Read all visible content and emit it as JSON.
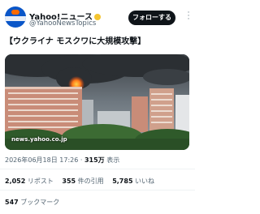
{
  "tweet": {
    "author_name": "Yahoo!ニュース",
    "author_handle": "@YahooNewsTopics",
    "follow_label": "フォローする",
    "text": "【ウクライナ モスクワに大規模攻撃】",
    "image_watermark": "news.yahoo.co.jp",
    "posted_at": "2026年06月18日 17:26 · ",
    "views_count": "315万",
    "views_label": " 表示"
  },
  "stats": {
    "retweets_count": "2,052",
    "retweets_label": " リポスト",
    "quotes_count": "355",
    "quotes_label": " 件の引用",
    "likes_count": "5,785",
    "likes_label": " いいね",
    "bookmarks_count": "547",
    "bookmarks_label": " ブックマーク"
  },
  "colors": {
    "follow_bg": "#0f1419",
    "secondary_text": "#536471",
    "verified_badge": "#f4c430",
    "smoke": "#2b2f33",
    "fire": "#ff6a1a"
  },
  "icons": [
    "verified-badge-icon",
    "more-options-icon"
  ]
}
